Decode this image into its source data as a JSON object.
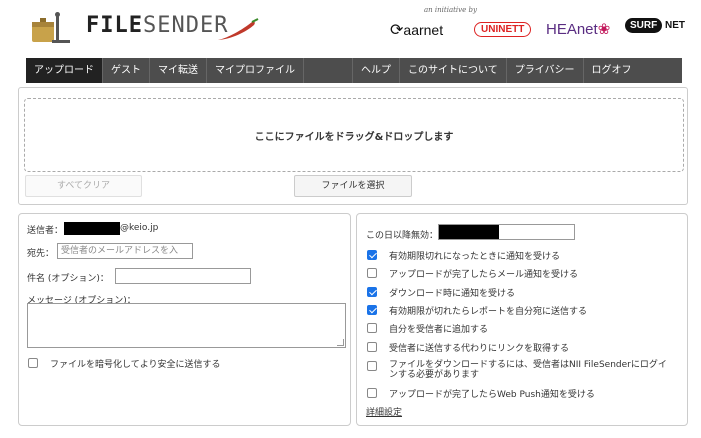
{
  "header": {
    "logo_bold": "FILE",
    "logo_light": "SENDER",
    "initiative": "an initiative by",
    "partners": {
      "aarnet": "aarnet",
      "uninett": "UNINETT",
      "heanet": "HEAnet",
      "surf_a": "SURF",
      "surf_b": "NET"
    },
    "colors": {
      "pepper": "#c0392b",
      "logo_box": "#c8a24a"
    }
  },
  "nav": {
    "tabs": [
      "アップロード",
      "ゲスト",
      "マイ転送",
      "マイプロファイル"
    ],
    "right_tabs": [
      "ヘルプ",
      "このサイトについて",
      "プライバシー",
      "ログオフ"
    ],
    "active_index": 0
  },
  "upload": {
    "drop_text": "ここにファイルをドラッグ&ドロップします",
    "clear_label": "すべてクリア",
    "select_label": "ファイルを選択"
  },
  "form": {
    "sender_label": "送信者：",
    "sender_domain": "@keio.jp",
    "to_label": "宛先：",
    "to_placeholder": "受信者のメールアドレスを入",
    "subject_label": "件名 (オプション)：",
    "message_label": "メッセージ (オプション)：",
    "encrypt_label": "ファイルを暗号化してより安全に送信する",
    "encrypt_checked": false
  },
  "options": {
    "expiry_label": "この日以降無効：",
    "items": [
      {
        "label": "有効期限切れになったときに通知を受ける",
        "checked": true
      },
      {
        "label": "アップロードが完了したらメール通知を受ける",
        "checked": false
      },
      {
        "label": "ダウンロード時に通知を受ける",
        "checked": true
      },
      {
        "label": "有効期限が切れたらレポートを自分宛に送信する",
        "checked": true
      },
      {
        "label": "自分を受信者に追加する",
        "checked": false
      },
      {
        "label": "受信者に送信する代わりにリンクを取得する",
        "checked": false
      },
      {
        "label_line1": "ファイルをダウンロードするには、受信者はNII FileSenderにログイ",
        "label_line2": "ンする必要があります",
        "checked": false
      },
      {
        "label": "アップロードが完了したらWeb Push通知を受ける",
        "checked": false
      }
    ],
    "advanced_link": "詳細設定"
  }
}
